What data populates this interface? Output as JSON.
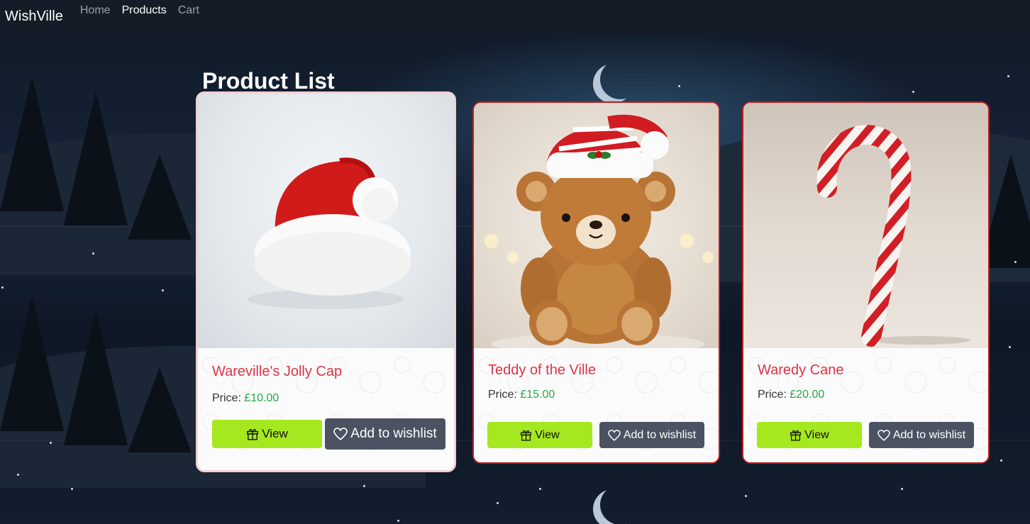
{
  "navbar": {
    "brand": "WishVille",
    "links": [
      {
        "label": "Home",
        "active": false
      },
      {
        "label": "Products",
        "active": true
      },
      {
        "label": "Cart",
        "active": false
      }
    ]
  },
  "page": {
    "title": "Product List"
  },
  "products": [
    {
      "name": "Wareville's Jolly Cap",
      "price_label": "Price:",
      "price": "£10.00",
      "view_label": "View",
      "wishlist_label": "Add to wishlist",
      "image": "santa-hat"
    },
    {
      "name": "Teddy of the Ville",
      "price_label": "Price:",
      "price": "£15.00",
      "view_label": "View",
      "wishlist_label": "Add to wishlist",
      "image": "teddy-bear"
    },
    {
      "name": "Waredy Cane",
      "price_label": "Price:",
      "price": "£20.00",
      "view_label": "View",
      "wishlist_label": "Add to wishlist",
      "image": "candy-cane"
    }
  ],
  "colors": {
    "accent_green": "#a5e81f",
    "wishlist_gray": "#4b5262",
    "title_red": "#dc3545",
    "price_green": "#28a745",
    "navbar_bg": "#151c28"
  }
}
